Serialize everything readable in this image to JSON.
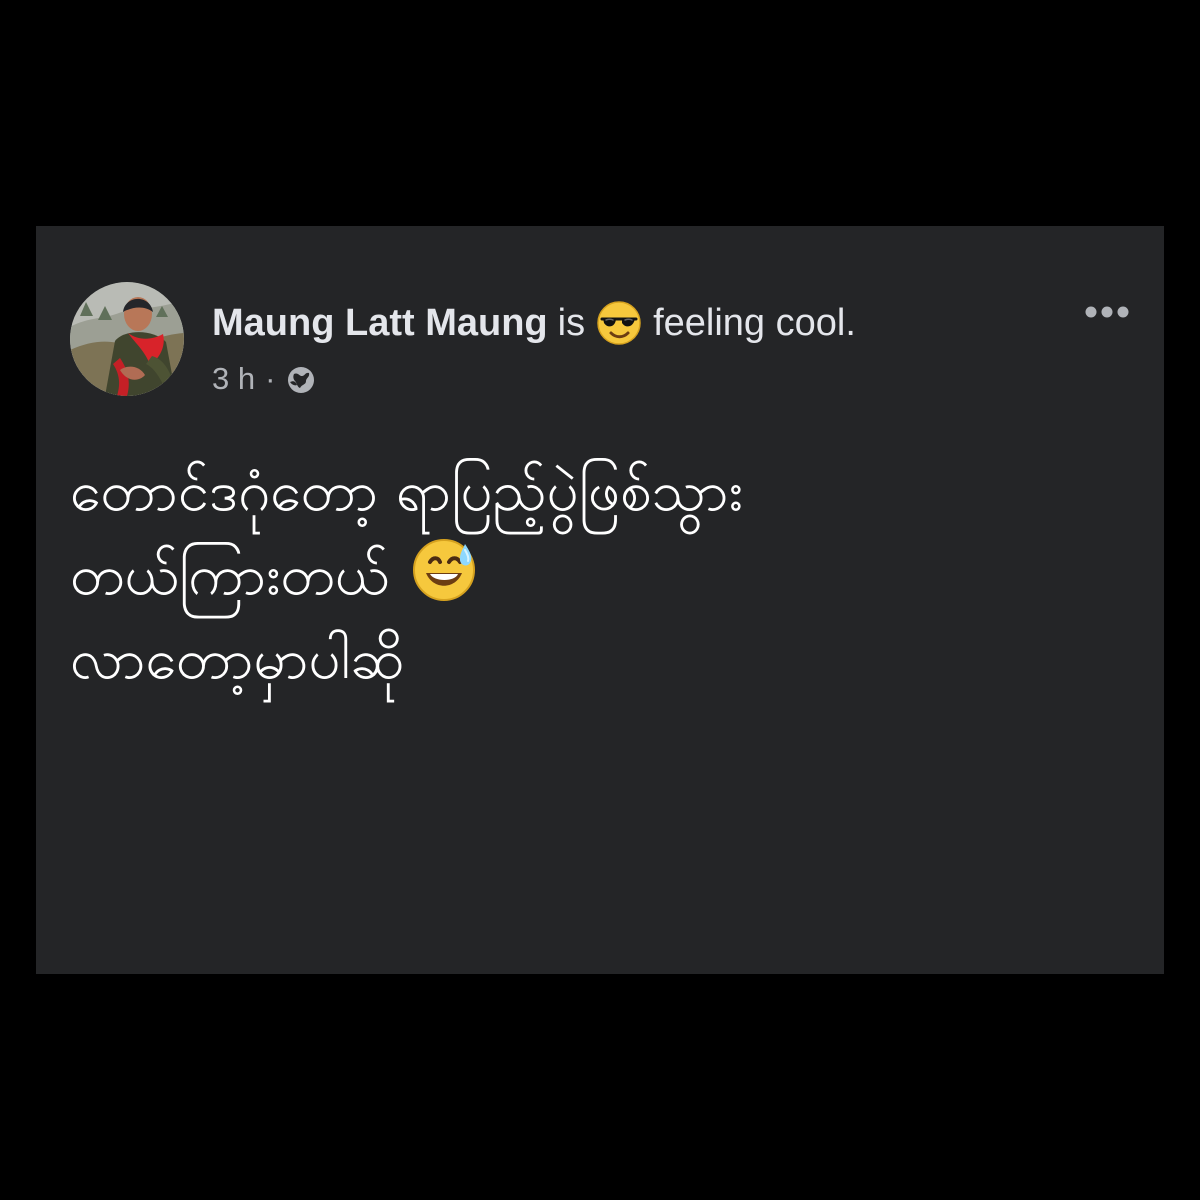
{
  "post": {
    "author_name": "Maung Latt Maung",
    "is_text": "is",
    "feeling_icon": "sunglasses-face-icon",
    "feeling_text": "feeling cool.",
    "timestamp": "3 h",
    "separator": "·",
    "privacy_icon": "globe-icon",
    "more_icon": "more-options-icon",
    "body_lines": [
      "တောင်ဒဂုံတော့ ရာပြည့်ပွဲဖြစ်သွား",
      "တယ်ကြားတယ်",
      "လာတော့မှာပါဆို"
    ],
    "inline_emoji": "grinning-sweat-face-icon"
  },
  "theme": {
    "page_background": "#000000",
    "card_background": "#242527",
    "primary_text": "#e4e6eb",
    "secondary_text": "#b0b3b8",
    "body_text": "#ffffff"
  }
}
